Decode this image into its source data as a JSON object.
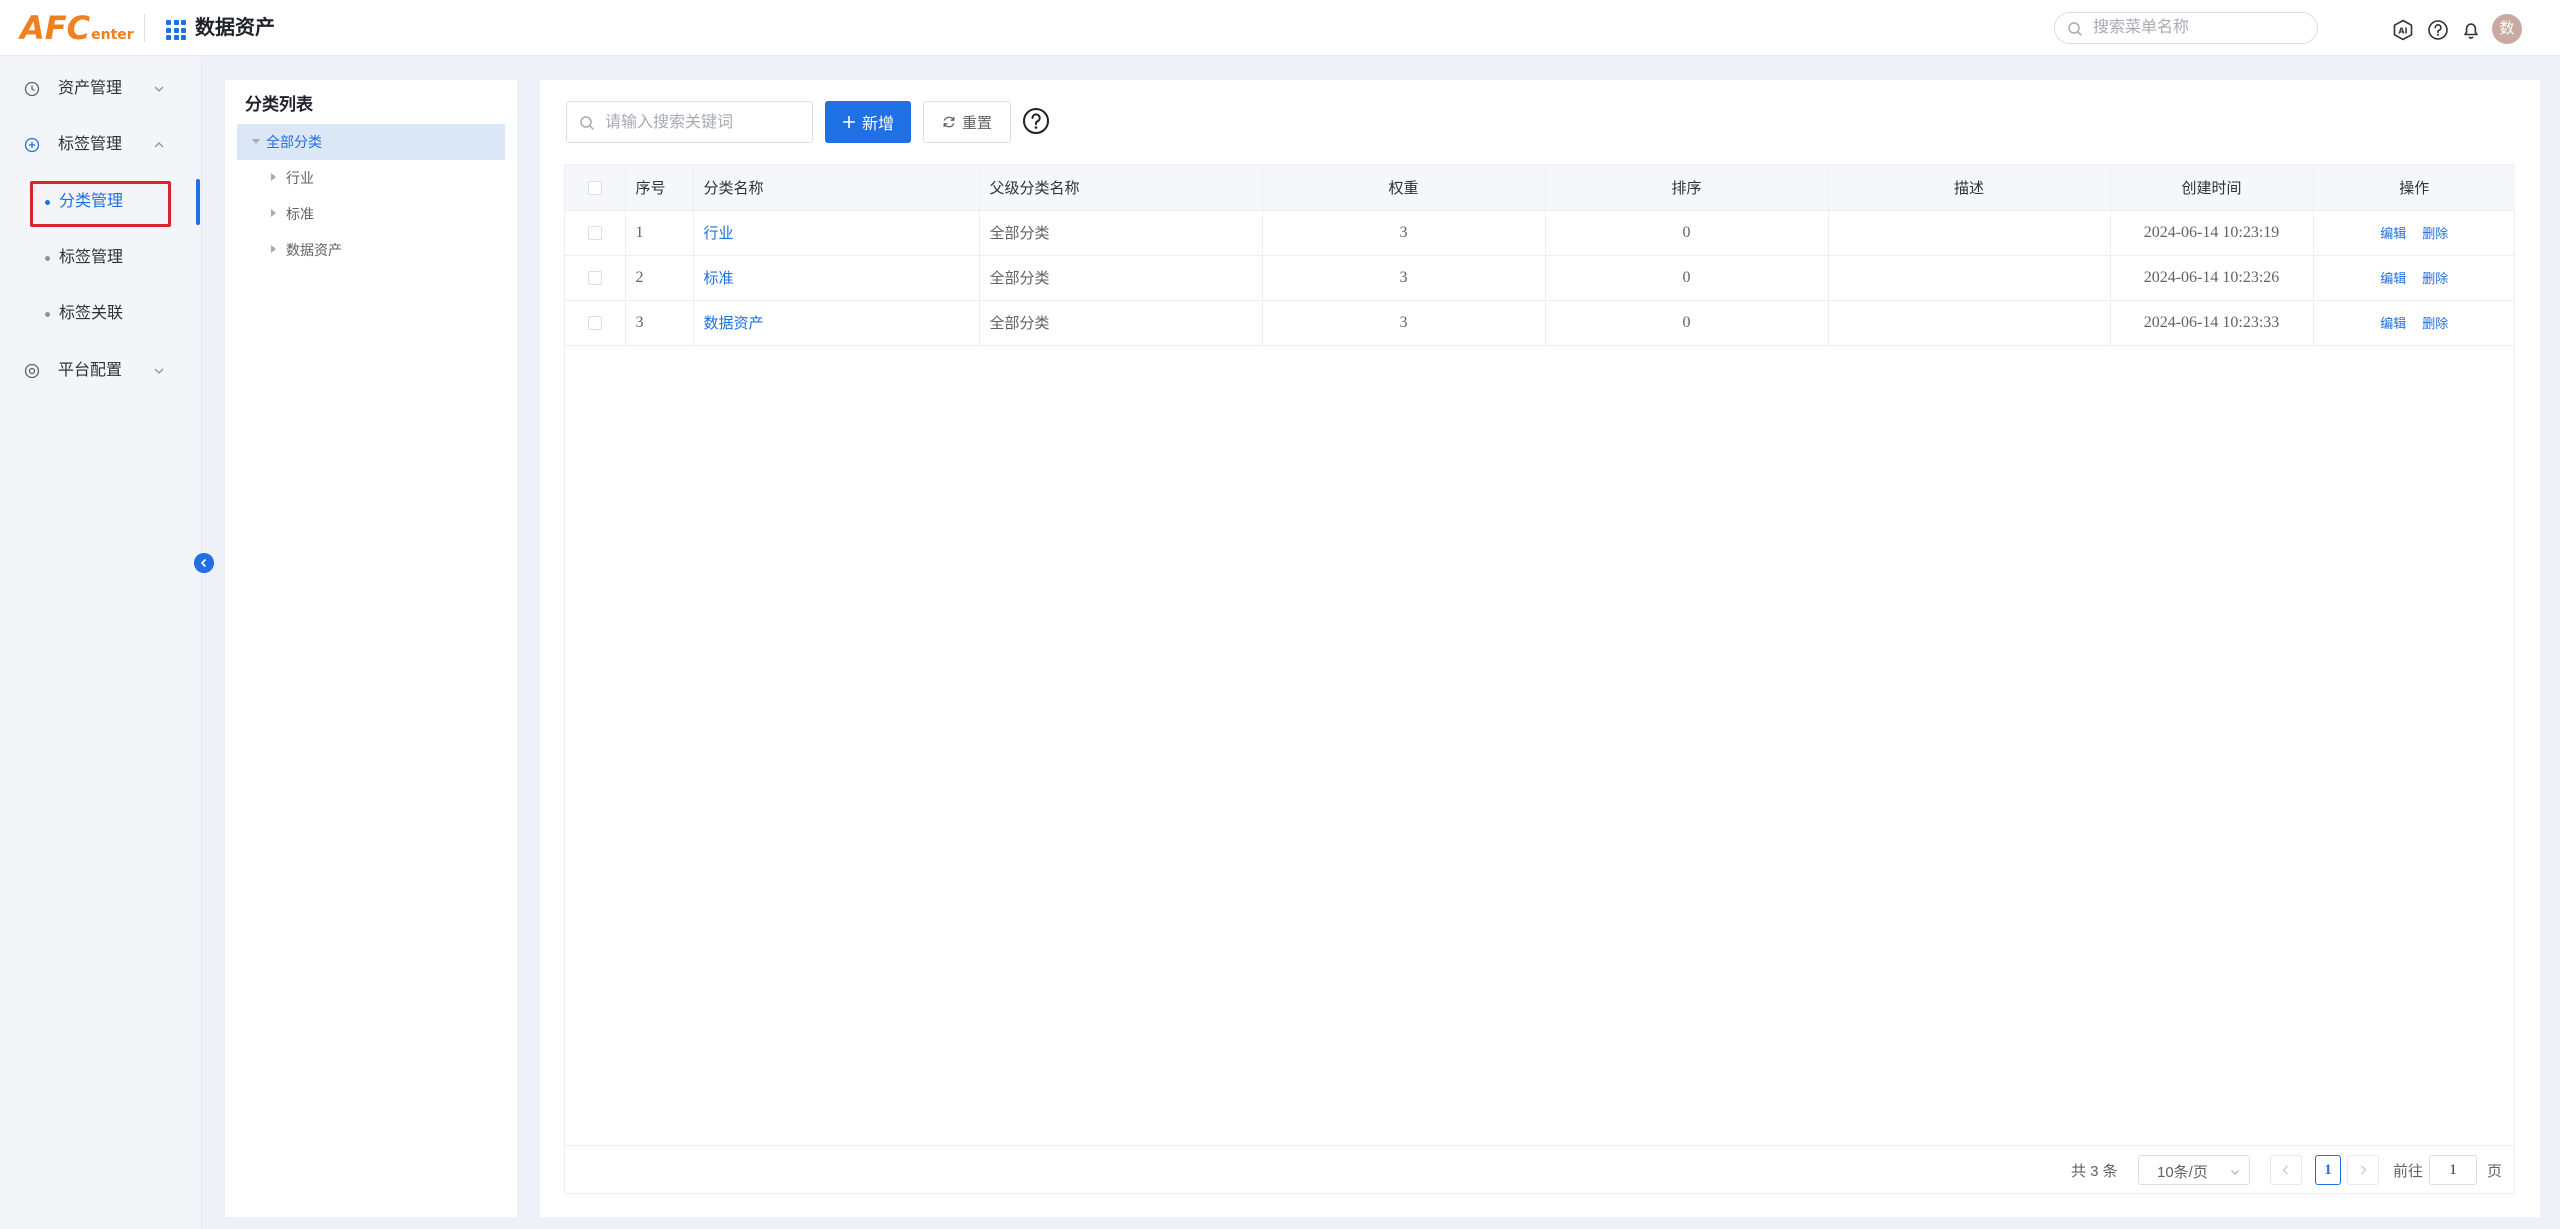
{
  "header": {
    "logo_main": "AFC",
    "logo_sub": "enter",
    "app_title": "数据资产",
    "menu_search_placeholder": "搜索菜单名称",
    "avatar_text": "数"
  },
  "sidebar": {
    "groups": [
      {
        "label": "资产管理",
        "icon": "clock-icon",
        "expanded": false
      },
      {
        "label": "标签管理",
        "icon": "plus-circle-icon",
        "expanded": true
      },
      {
        "label": "平台配置",
        "icon": "target-icon",
        "expanded": false
      }
    ],
    "sub_items": [
      {
        "label": "分类管理",
        "active": true
      },
      {
        "label": "标签管理",
        "active": false
      },
      {
        "label": "标签关联",
        "active": false
      }
    ]
  },
  "tree": {
    "title": "分类列表",
    "root": "全部分类",
    "children": [
      "行业",
      "标准",
      "数据资产"
    ]
  },
  "toolbar": {
    "search_placeholder": "请输入搜索关键词",
    "add_label": "新增",
    "reset_label": "重置"
  },
  "table": {
    "columns": [
      "序号",
      "分类名称",
      "父级分类名称",
      "权重",
      "排序",
      "描述",
      "创建时间",
      "操作"
    ],
    "rows": [
      {
        "index": "1",
        "name": "行业",
        "parent": "全部分类",
        "weight": "3",
        "order": "0",
        "desc": "",
        "created": "2024-06-14 10:23:19"
      },
      {
        "index": "2",
        "name": "标准",
        "parent": "全部分类",
        "weight": "3",
        "order": "0",
        "desc": "",
        "created": "2024-06-14 10:23:26"
      },
      {
        "index": "3",
        "name": "数据资产",
        "parent": "全部分类",
        "weight": "3",
        "order": "0",
        "desc": "",
        "created": "2024-06-14 10:23:33"
      }
    ],
    "actions": {
      "edit": "编辑",
      "delete": "删除"
    }
  },
  "pagination": {
    "total_text": "共 3 条",
    "page_size": "10条/页",
    "current_page": "1",
    "goto_label": "前往",
    "goto_value": "1",
    "goto_unit": "页"
  },
  "colors": {
    "primary": "#1f6fe5",
    "logo": "#f0801e",
    "highlight_box": "#d9232d"
  }
}
